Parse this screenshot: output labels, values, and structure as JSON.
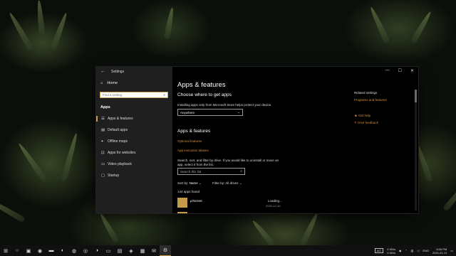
{
  "window": {
    "title": "Settings",
    "controls": {
      "minimize": "—",
      "maximize": "☐",
      "close": "✕"
    }
  },
  "nav": {
    "home": "Home",
    "search_placeholder": "Find a setting",
    "section": "Apps",
    "items": [
      {
        "label": "Apps & features",
        "icon": "list-icon",
        "glyph": "☰"
      },
      {
        "label": "Default apps",
        "icon": "default-apps-icon",
        "glyph": "▤"
      },
      {
        "label": "Offline maps",
        "icon": "map-icon",
        "glyph": "⌖"
      },
      {
        "label": "Apps for websites",
        "icon": "web-icon",
        "glyph": "⊡"
      },
      {
        "label": "Video playback",
        "icon": "video-icon",
        "glyph": "▭"
      },
      {
        "label": "Startup",
        "icon": "startup-icon",
        "glyph": "▢"
      }
    ]
  },
  "main": {
    "title": "Apps & features",
    "get_apps_heading": "Choose where to get apps",
    "get_apps_desc": "Installing apps only from Microsoft Store helps protect your device.",
    "get_apps_value": "Anywhere",
    "apps_heading": "Apps & features",
    "optional_features": "Optional features",
    "app_aliases": "App execution aliases",
    "search_desc_1": "Search, sort, and filter by drive. If you would like to uninstall or move an",
    "search_desc_2": "app, select it from the list.",
    "list_search_placeholder": "Search this list",
    "sort_label": "Sort by:",
    "sort_value": "Name",
    "filter_label": "Filter by:",
    "filter_value": "All drives",
    "apps_found": "144 apps found",
    "app": {
      "name": "µTorrent",
      "status": "Loading...",
      "date": "2020-12-10"
    }
  },
  "related": {
    "heading": "Related settings",
    "link": "Programs and features",
    "help": "Get help",
    "feedback": "Give feedback"
  },
  "taskbar": {
    "tray_box": "A/C",
    "net_1": "0 KB/s",
    "net_2": "0 KB/s",
    "lang": "ENG",
    "time": "5:06 PM",
    "date": "2021-01-11"
  },
  "colors": {
    "accent": "#d08b3a",
    "window_bg": "#000000",
    "nav_bg": "#1f1f1f"
  }
}
